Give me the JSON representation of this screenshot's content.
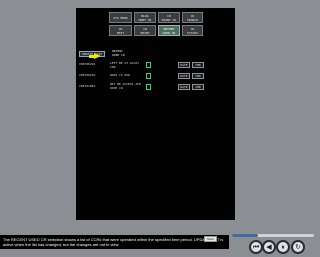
{
  "tabs_row1": [
    {
      "label": "SYS MENU"
    },
    {
      "label": "BLDG\nMGMT CR"
    },
    {
      "label": "CR\nMAINT CR"
    },
    {
      "label": "CR\nSEARCH"
    }
  ],
  "tabs_row2": [
    {
      "label": "CR\nEDIT"
    },
    {
      "label": "CR\nPRINT"
    },
    {
      "label": "RECENT\nUSED CR",
      "active": true
    },
    {
      "label": "CR\nSTATUS"
    }
  ],
  "toolbar": {
    "update_label": "UPDATE LIST"
  },
  "list": {
    "header": "RECENT\nUSED CR"
  },
  "rows": [
    {
      "cr": "CR0700216",
      "info": "LEFT BE AT ACC01\nCR8",
      "date_label": "DATE",
      "cmd_label": "CMD"
    },
    {
      "cr": "CR0700216",
      "info": "WAR3 CS PAR",
      "date_label": "DATE",
      "cmd_label": "CMD"
    },
    {
      "cr": "CR0701081",
      "info": "NIT BE ACCESS IFR\nUSED CR",
      "date_label": "DATE",
      "cmd_label": "CMD"
    }
  ],
  "caption": {
    "text": "The RECENT USED CR selection shows a list of CCRs that were operated within the specified time period. UPDATE LIST is active when the list has changed, but the changes are not in view.",
    "mute_label": "Mute"
  },
  "player": {
    "progress": 0.32
  },
  "colors": {
    "accent_green": "#39d36a",
    "pointer": "#f2e600",
    "active_tab": "#4b6f5c"
  }
}
